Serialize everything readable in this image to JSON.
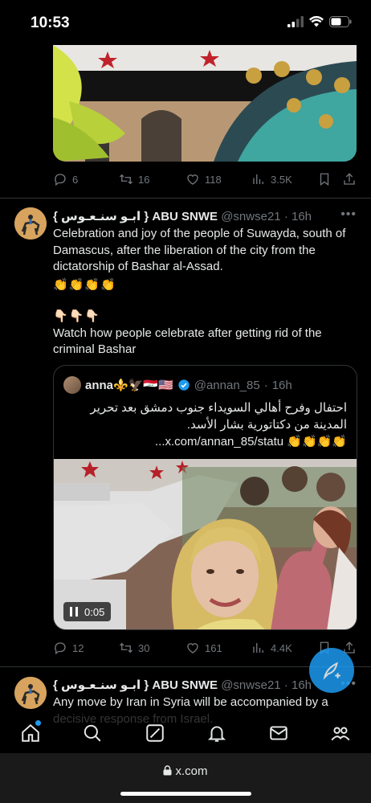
{
  "status_bar": {
    "time": "10:53"
  },
  "post1": {
    "replies": "6",
    "reposts": "16",
    "likes": "118",
    "views": "3.5K"
  },
  "post2": {
    "display_name": "{ ابـو سنـعـوس } ABU SNWE",
    "handle": "@snwse21",
    "time": "16h",
    "text_line1": "Celebration and joy of the people of Suwayda, south of Damascus, after the liberation of the city from the dictatorship of Bashar al-Assad.",
    "emoji_clap": "👏👏👏👏",
    "emoji_point": "👇🏻👇🏻👇🏻",
    "text_line2": "Watch how people celebrate after getting rid of the criminal Bashar",
    "quote": {
      "display_name": "anna⚜️🦅🇮🇶🇺🇸",
      "handle": "@annan_85",
      "time": "16h",
      "text": "احتفال وفرح أهالي السويداء جنوب دمشق بعد تحرير المدينة من دكتاتورية بشار الأسد.",
      "text_tail": "👏👏👏👏 x.com/annan_85/statu...",
      "video_time": "0:05"
    },
    "replies": "12",
    "reposts": "30",
    "likes": "161",
    "views": "4.4K"
  },
  "post3": {
    "display_name": "{ ابـو سنـعـوس } ABU SNWE",
    "handle": "@snwse21",
    "time": "16h",
    "text": "Any move by Iran in Syria will be accompanied by a decisive response from Israel."
  },
  "browser": {
    "url": "x.com"
  },
  "colors": {
    "accent": "#1d9bf0",
    "muted": "#71767b",
    "text": "#e7e9ea",
    "background": "#000000"
  },
  "icons": [
    "reply-icon",
    "repost-icon",
    "like-icon",
    "views-icon",
    "bookmark-icon",
    "share-icon",
    "home-icon",
    "search-icon",
    "grok-icon",
    "notifications-icon",
    "messages-icon",
    "communities-icon",
    "compose-icon",
    "lock-icon"
  ]
}
